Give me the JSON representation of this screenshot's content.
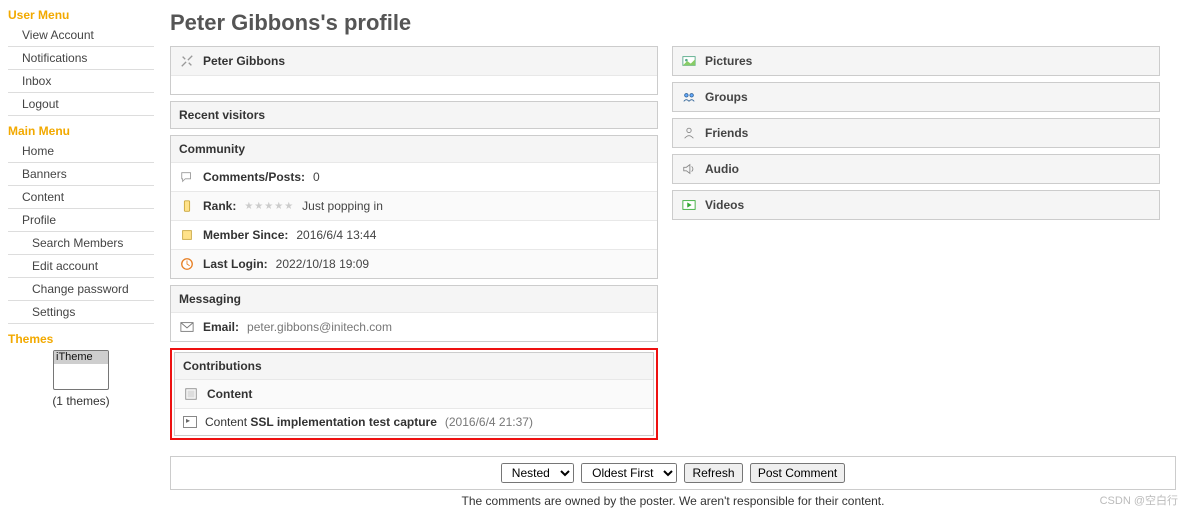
{
  "sidebar": {
    "userMenuTitle": "User Menu",
    "userMenu": [
      "View Account",
      "Notifications",
      "Inbox",
      "Logout"
    ],
    "mainMenuTitle": "Main Menu",
    "mainMenu": [
      "Home",
      "Banners",
      "Content",
      "Profile",
      "Search Members",
      "Edit account",
      "Change password",
      "Settings"
    ],
    "themesTitle": "Themes",
    "themeOption": "iTheme",
    "themesCount": "(1 themes)"
  },
  "page": {
    "title": "Peter Gibbons's profile"
  },
  "profile": {
    "name": "Peter Gibbons",
    "recentVisitors": "Recent visitors",
    "communityTitle": "Community",
    "commentsLabel": "Comments/Posts:",
    "commentsValue": "0",
    "rankLabel": "Rank:",
    "rankText": "Just popping in",
    "memberSinceLabel": "Member Since:",
    "memberSinceValue": "2016/6/4 13:44",
    "lastLoginLabel": "Last Login:",
    "lastLoginValue": "2022/10/18 19:09",
    "messagingTitle": "Messaging",
    "emailLabel": "Email:",
    "emailValue": "peter.gibbons@initech.com",
    "contributionsTitle": "Contributions",
    "contentHeader": "Content",
    "contributionLinkPrefix": "Content ",
    "contributionLinkText": "SSL implementation test capture",
    "contributionDate": "(2016/6/4 21:37)"
  },
  "rightPanels": [
    "Pictures",
    "Groups",
    "Friends",
    "Audio",
    "Videos"
  ],
  "comments": {
    "viewMode": "Nested",
    "sortMode": "Oldest First",
    "refresh": "Refresh",
    "post": "Post Comment",
    "note": "The comments are owned by the poster. We aren't responsible for their content."
  },
  "watermark": "CSDN @空白行"
}
